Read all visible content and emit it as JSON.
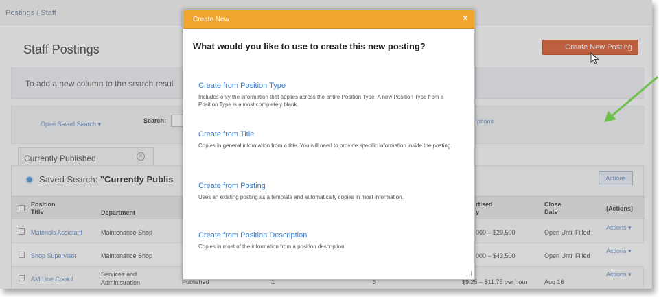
{
  "breadcrumb": "Postings  /  Staff",
  "page_title": "Staff Postings",
  "create_posting_button": "Create New Posting",
  "info_text": "To add a new column to the search resul",
  "search": {
    "open_saved_search": "Open Saved Search ▾",
    "label": "Search:",
    "advanced_options": "ptions"
  },
  "tabs": [
    {
      "label": "Currently Published"
    }
  ],
  "saved_search": {
    "prefix": "Saved Search: ",
    "name": "\"Currently Publis"
  },
  "actions_button": "Actions",
  "table": {
    "headers": {
      "position_title": "Position\nTitle",
      "department": "Department",
      "advertised": "rtised\ny",
      "close_date": "Close\nDate",
      "actions": "(Actions)"
    },
    "rows": [
      {
        "title": "Materials Assistant",
        "department": "Maintenance Shop",
        "status": "",
        "col4": "",
        "col5": "",
        "salary": "000 – $29,500",
        "close_date": "Open Until Filled",
        "actions": "Actions ▾"
      },
      {
        "title": "Shop Supervisor",
        "department": "Maintenance Shop",
        "status": "",
        "col4": "",
        "col5": "",
        "salary": "000 – $43,500",
        "close_date": "Open Until Filled",
        "actions": "Actions ▾"
      },
      {
        "title": "AM Line Cook I",
        "department": "Services and\nAdministration",
        "status": "Published",
        "col4": "1",
        "col5": "3",
        "salary": "$9.25 – $11.75 per hour",
        "close_date": "Aug 16",
        "actions": "Actions ▾"
      }
    ]
  },
  "modal": {
    "header": "Create New",
    "close": "×",
    "question": "What would you like to use to create this new posting?",
    "options": [
      {
        "title": "Create from Position Type",
        "description": "Includes only the information that applies across the entire Position Type. A new Position Type from a Position Type is almost completely blank."
      },
      {
        "title": "Create from Title",
        "description": "Copies in general information from a title. You will need to provide specific information inside the posting."
      },
      {
        "title": "Create from Posting",
        "description": "Uses an existing posting as a template and automatically copies in most information."
      },
      {
        "title": "Create from Position Description",
        "description": "Copies in most of the information from a position description."
      }
    ]
  },
  "colors": {
    "accent_orange": "#f2a52e",
    "create_button": "#d9582b",
    "link_blue": "#3b7dc8",
    "annotation_arrow": "#6cc04a"
  }
}
